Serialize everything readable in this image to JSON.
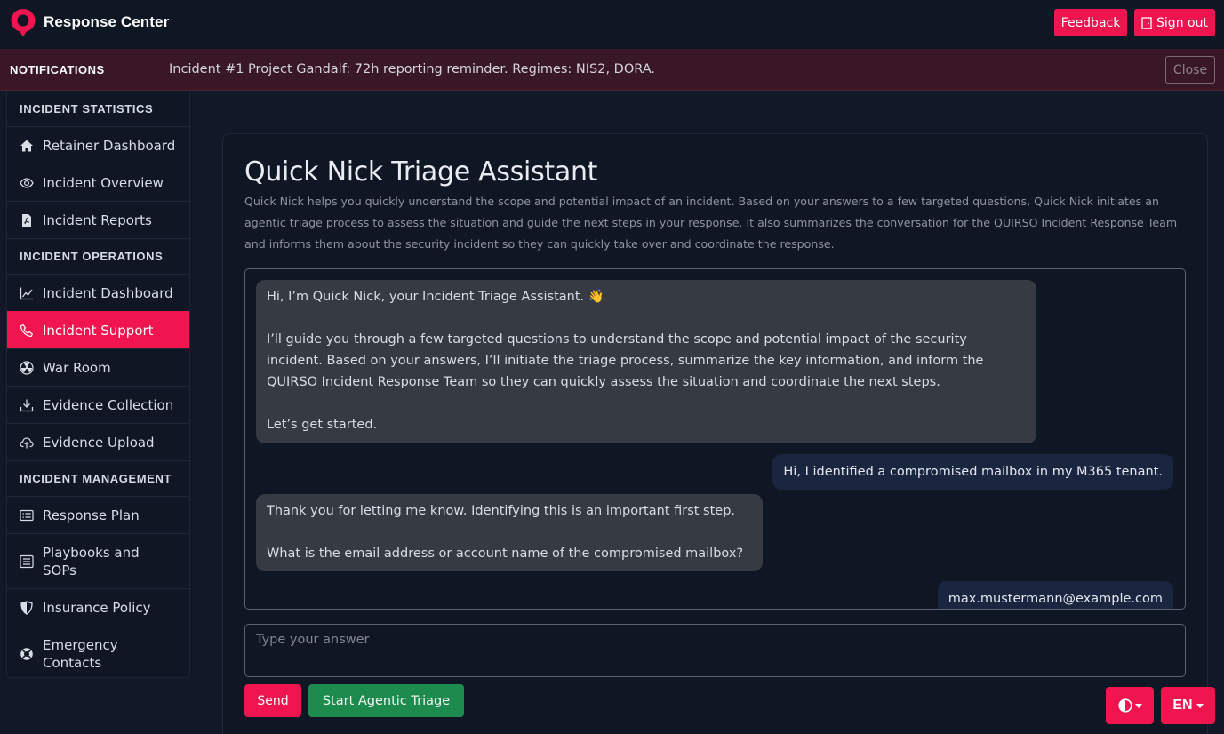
{
  "app": {
    "title": "Response Center",
    "accent": "#f0144f",
    "success": "#1d8a4e",
    "logo_icon": "map-pin-logo-icon"
  },
  "header": {
    "feedback_label": "Feedback",
    "signout_label": "Sign out",
    "signout_icon": "door-exit-icon"
  },
  "notifications": {
    "label": "NOTIFICATIONS",
    "message": "Incident #1 Project Gandalf: 72h reporting reminder. Regimes: NIS2, DORA.",
    "close_label": "Close"
  },
  "sidebar": {
    "sections": [
      {
        "heading": "INCIDENT STATISTICS",
        "items": [
          {
            "label": "Retainer Dashboard",
            "icon": "house-icon"
          },
          {
            "label": "Incident Overview",
            "icon": "eye-icon"
          },
          {
            "label": "Incident Reports",
            "icon": "pdf-file-icon"
          }
        ]
      },
      {
        "heading": "INCIDENT OPERATIONS",
        "items": [
          {
            "label": "Incident Dashboard",
            "icon": "line-chart-icon"
          },
          {
            "label": "Incident Support",
            "icon": "phone-icon",
            "active": true
          },
          {
            "label": "War Room",
            "icon": "radioactive-icon"
          },
          {
            "label": "Evidence Collection",
            "icon": "download-icon"
          },
          {
            "label": "Evidence Upload",
            "icon": "cloud-upload-icon"
          }
        ]
      },
      {
        "heading": "INCIDENT MANAGEMENT",
        "items": [
          {
            "label": "Response Plan",
            "icon": "card-list-icon"
          },
          {
            "label": "Playbooks and SOPs",
            "icon": "text-list-icon"
          },
          {
            "label": "Insurance Policy",
            "icon": "shield-half-icon"
          },
          {
            "label": "Emergency Contacts",
            "icon": "life-ring-icon"
          }
        ]
      }
    ]
  },
  "main": {
    "title": "Quick Nick Triage Assistant",
    "description": "Quick Nick helps you quickly understand the scope and potential impact of an incident. Based on your answers to a few targeted questions, Quick Nick initiates an agentic triage process to assess the situation and guide the next steps in your response. It also summarizes the conversation for the QUIRSO Incident Response Team and informs them about the security incident so they can quickly take over and coordinate the response.",
    "messages": [
      {
        "role": "assistant",
        "text": "Hi, I’m Quick Nick, your Incident Triage Assistant. 👋\n\nI’ll guide you through a few targeted questions to understand the scope and potential impact of the security incident. Based on your answers, I’ll initiate the triage process, summarize the key information, and inform the QUIRSO Incident Response Team so they can quickly assess the situation and coordinate the next steps.\n\nLet’s get started."
      },
      {
        "role": "user",
        "text": "Hi, I identified a compromised mailbox in my M365 tenant."
      },
      {
        "role": "assistant",
        "text": "Thank you for letting me know. Identifying this is an important first step.\n\nWhat is the email address or account name of the compromised mailbox?"
      },
      {
        "role": "user",
        "text": "max.mustermann@example.com"
      }
    ],
    "input_placeholder": "Type your answer",
    "send_label": "Send",
    "triage_label": "Start Agentic Triage"
  },
  "footer_controls": {
    "theme_icon": "contrast-half-circle-icon",
    "language": "EN"
  }
}
